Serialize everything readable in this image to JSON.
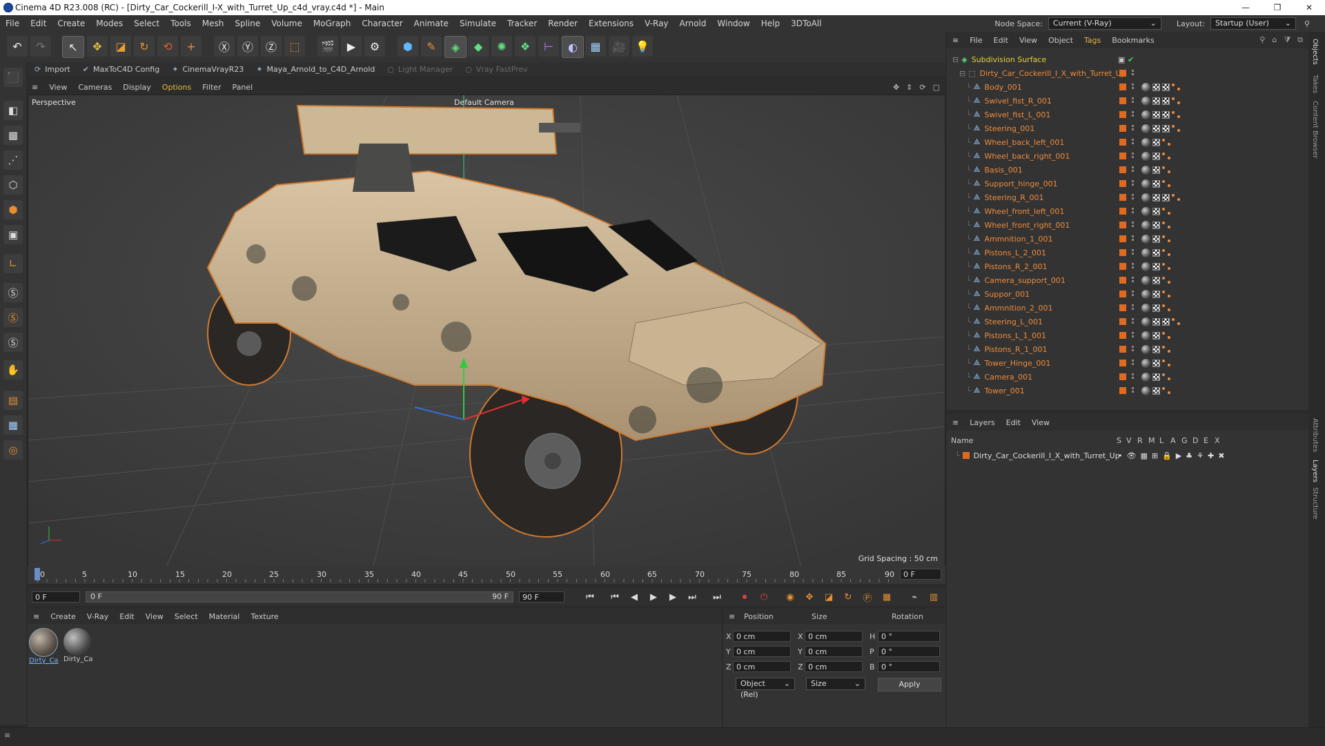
{
  "window": {
    "title": "Cinema 4D R23.008 (RC) - [Dirty_Car_Cockerill_I-X_with_Turret_Up_c4d_vray.c4d *] - Main",
    "min": "—",
    "max": "❐",
    "close": "✕"
  },
  "menubar": {
    "items": [
      "File",
      "Edit",
      "Create",
      "Modes",
      "Select",
      "Tools",
      "Mesh",
      "Spline",
      "Volume",
      "MoGraph",
      "Character",
      "Animate",
      "Simulate",
      "Tracker",
      "Render",
      "Extensions",
      "V-Ray",
      "Arnold",
      "Window",
      "Help",
      "3DToAll"
    ],
    "node_space_label": "Node Space:",
    "node_space_value": "Current (V-Ray)",
    "layout_label": "Layout:",
    "layout_value": "Startup (User)"
  },
  "plugin_bar": {
    "items": [
      "Import",
      "MaxToC4D Config",
      "CinemaVrayR23",
      "Maya_Arnold_to_C4D_Arnold",
      "Light Manager",
      "Vray FastPrev"
    ]
  },
  "viewport": {
    "menu": [
      "View",
      "Cameras",
      "Display",
      "Options",
      "Filter",
      "Panel"
    ],
    "view_name": "Perspective",
    "camera": "Default Camera",
    "grid_spacing": "Grid Spacing : 50 cm"
  },
  "timeline": {
    "ticks": [
      "0",
      "5",
      "10",
      "15",
      "20",
      "25",
      "30",
      "35",
      "40",
      "45",
      "50",
      "55",
      "60",
      "65",
      "70",
      "75",
      "80",
      "85",
      "90"
    ],
    "current_frame": "0 F"
  },
  "transport": {
    "start": "0 F",
    "range_start": "0 F",
    "range_end": "90 F",
    "end": "90 F"
  },
  "material_panel": {
    "menu": [
      "Create",
      "V-Ray",
      "Edit",
      "View",
      "Select",
      "Material",
      "Texture"
    ],
    "materials": [
      "Dirty_Ca",
      "Dirty_Ca"
    ]
  },
  "attributes": {
    "headers": [
      "Position",
      "Size",
      "Rotation"
    ],
    "rows": [
      {
        "axis": "X",
        "pos": "0 cm",
        "size_axis": "X",
        "size": "0 cm",
        "rot_axis": "H",
        "rot": "0 °"
      },
      {
        "axis": "Y",
        "pos": "0 cm",
        "size_axis": "Y",
        "size": "0 cm",
        "rot_axis": "P",
        "rot": "0 °"
      },
      {
        "axis": "Z",
        "pos": "0 cm",
        "size_axis": "Z",
        "size": "0 cm",
        "rot_axis": "B",
        "rot": "0 °"
      }
    ],
    "coord_mode": "Object (Rel)",
    "size_mode": "Size",
    "apply": "Apply"
  },
  "object_manager": {
    "menu": [
      "File",
      "Edit",
      "View",
      "Object",
      "Tags",
      "Bookmarks"
    ],
    "root": "Subdivision Surface",
    "group": "Dirty_Car_Cockerill_I_X_with_Turret_Up",
    "objects": [
      {
        "name": "Body_001",
        "tags": "sphere-chk-chk-dots"
      },
      {
        "name": "Swivel_fist_R_001",
        "tags": "sphere-chk-chk-dots"
      },
      {
        "name": "Swivel_fist_L_001",
        "tags": "sphere-chk-chk-dots"
      },
      {
        "name": "Steering_001",
        "tags": "sphere-chk-chk-dots"
      },
      {
        "name": "Wheel_back_left_001",
        "tags": "sphere-chk-dots"
      },
      {
        "name": "Wheel_back_right_001",
        "tags": "sphere-chk-dots"
      },
      {
        "name": "Basis_001",
        "tags": "sphere-chk-dots"
      },
      {
        "name": "Support_hinge_001",
        "tags": "sphere-chk-dots"
      },
      {
        "name": "Steering_R_001",
        "tags": "sphere-chk-chk-dots"
      },
      {
        "name": "Wheel_front_left_001",
        "tags": "sphere-chk-dots"
      },
      {
        "name": "Wheel_front_right_001",
        "tags": "sphere-chk-dots"
      },
      {
        "name": "Ammnition_1_001",
        "tags": "sphere-chk-dots"
      },
      {
        "name": "Pistons_L_2_001",
        "tags": "sphere-chk-dots"
      },
      {
        "name": "Pistons_R_2_001",
        "tags": "sphere-chk-dots"
      },
      {
        "name": "Camera_support_001",
        "tags": "sphere-chk-dots"
      },
      {
        "name": "Suppor_001",
        "tags": "sphere-chk-dots"
      },
      {
        "name": "Ammnition_2_001",
        "tags": "sphere-chk-dots"
      },
      {
        "name": "Steering_L_001",
        "tags": "sphere-chk-chk-dots"
      },
      {
        "name": "Pistons_L_1_001",
        "tags": "sphere-chk-dots"
      },
      {
        "name": "Pistons_R_1_001",
        "tags": "sphere-chk-dots"
      },
      {
        "name": "Tower_Hinge_001",
        "tags": "sphere-chk-dots"
      },
      {
        "name": "Camera_001",
        "tags": "sphere-chk-dots"
      },
      {
        "name": "Tower_001",
        "tags": "sphere-chk-dots"
      }
    ]
  },
  "layer_manager": {
    "menu": [
      "Layers",
      "Edit",
      "View"
    ],
    "name_header": "Name",
    "columns": [
      "S",
      "V",
      "R",
      "M",
      "L",
      "A",
      "G",
      "D",
      "E",
      "X"
    ],
    "layers": [
      {
        "name": "Dirty_Car_Cockerill_I_X_with_Turret_Up"
      }
    ]
  },
  "side_tabs": [
    "Objects",
    "Takes",
    "Content Browser",
    "Attributes",
    "Layers",
    "Structure"
  ],
  "colors": {
    "accent": "#f08c3c",
    "root_name": "#e8d23c",
    "layer_color": "#e06a20"
  }
}
